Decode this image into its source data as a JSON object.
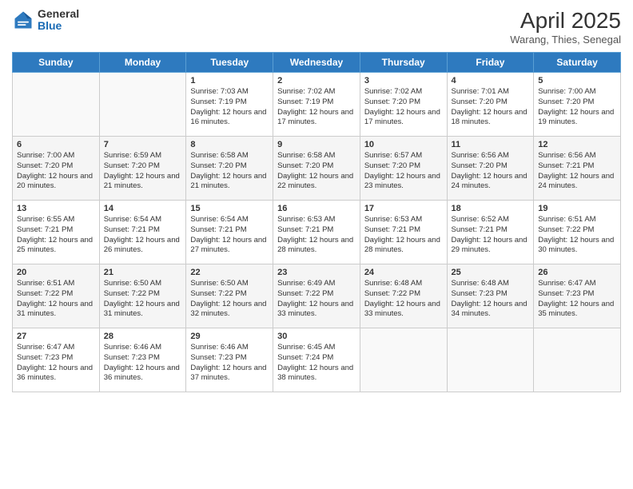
{
  "header": {
    "logo_general": "General",
    "logo_blue": "Blue",
    "title": "April 2025",
    "location": "Warang, Thies, Senegal"
  },
  "weekdays": [
    "Sunday",
    "Monday",
    "Tuesday",
    "Wednesday",
    "Thursday",
    "Friday",
    "Saturday"
  ],
  "weeks": [
    [
      {
        "day": "",
        "sunrise": "",
        "sunset": "",
        "daylight": ""
      },
      {
        "day": "",
        "sunrise": "",
        "sunset": "",
        "daylight": ""
      },
      {
        "day": "1",
        "sunrise": "Sunrise: 7:03 AM",
        "sunset": "Sunset: 7:19 PM",
        "daylight": "Daylight: 12 hours and 16 minutes."
      },
      {
        "day": "2",
        "sunrise": "Sunrise: 7:02 AM",
        "sunset": "Sunset: 7:19 PM",
        "daylight": "Daylight: 12 hours and 17 minutes."
      },
      {
        "day": "3",
        "sunrise": "Sunrise: 7:02 AM",
        "sunset": "Sunset: 7:20 PM",
        "daylight": "Daylight: 12 hours and 17 minutes."
      },
      {
        "day": "4",
        "sunrise": "Sunrise: 7:01 AM",
        "sunset": "Sunset: 7:20 PM",
        "daylight": "Daylight: 12 hours and 18 minutes."
      },
      {
        "day": "5",
        "sunrise": "Sunrise: 7:00 AM",
        "sunset": "Sunset: 7:20 PM",
        "daylight": "Daylight: 12 hours and 19 minutes."
      }
    ],
    [
      {
        "day": "6",
        "sunrise": "Sunrise: 7:00 AM",
        "sunset": "Sunset: 7:20 PM",
        "daylight": "Daylight: 12 hours and 20 minutes."
      },
      {
        "day": "7",
        "sunrise": "Sunrise: 6:59 AM",
        "sunset": "Sunset: 7:20 PM",
        "daylight": "Daylight: 12 hours and 21 minutes."
      },
      {
        "day": "8",
        "sunrise": "Sunrise: 6:58 AM",
        "sunset": "Sunset: 7:20 PM",
        "daylight": "Daylight: 12 hours and 21 minutes."
      },
      {
        "day": "9",
        "sunrise": "Sunrise: 6:58 AM",
        "sunset": "Sunset: 7:20 PM",
        "daylight": "Daylight: 12 hours and 22 minutes."
      },
      {
        "day": "10",
        "sunrise": "Sunrise: 6:57 AM",
        "sunset": "Sunset: 7:20 PM",
        "daylight": "Daylight: 12 hours and 23 minutes."
      },
      {
        "day": "11",
        "sunrise": "Sunrise: 6:56 AM",
        "sunset": "Sunset: 7:20 PM",
        "daylight": "Daylight: 12 hours and 24 minutes."
      },
      {
        "day": "12",
        "sunrise": "Sunrise: 6:56 AM",
        "sunset": "Sunset: 7:21 PM",
        "daylight": "Daylight: 12 hours and 24 minutes."
      }
    ],
    [
      {
        "day": "13",
        "sunrise": "Sunrise: 6:55 AM",
        "sunset": "Sunset: 7:21 PM",
        "daylight": "Daylight: 12 hours and 25 minutes."
      },
      {
        "day": "14",
        "sunrise": "Sunrise: 6:54 AM",
        "sunset": "Sunset: 7:21 PM",
        "daylight": "Daylight: 12 hours and 26 minutes."
      },
      {
        "day": "15",
        "sunrise": "Sunrise: 6:54 AM",
        "sunset": "Sunset: 7:21 PM",
        "daylight": "Daylight: 12 hours and 27 minutes."
      },
      {
        "day": "16",
        "sunrise": "Sunrise: 6:53 AM",
        "sunset": "Sunset: 7:21 PM",
        "daylight": "Daylight: 12 hours and 28 minutes."
      },
      {
        "day": "17",
        "sunrise": "Sunrise: 6:53 AM",
        "sunset": "Sunset: 7:21 PM",
        "daylight": "Daylight: 12 hours and 28 minutes."
      },
      {
        "day": "18",
        "sunrise": "Sunrise: 6:52 AM",
        "sunset": "Sunset: 7:21 PM",
        "daylight": "Daylight: 12 hours and 29 minutes."
      },
      {
        "day": "19",
        "sunrise": "Sunrise: 6:51 AM",
        "sunset": "Sunset: 7:22 PM",
        "daylight": "Daylight: 12 hours and 30 minutes."
      }
    ],
    [
      {
        "day": "20",
        "sunrise": "Sunrise: 6:51 AM",
        "sunset": "Sunset: 7:22 PM",
        "daylight": "Daylight: 12 hours and 31 minutes."
      },
      {
        "day": "21",
        "sunrise": "Sunrise: 6:50 AM",
        "sunset": "Sunset: 7:22 PM",
        "daylight": "Daylight: 12 hours and 31 minutes."
      },
      {
        "day": "22",
        "sunrise": "Sunrise: 6:50 AM",
        "sunset": "Sunset: 7:22 PM",
        "daylight": "Daylight: 12 hours and 32 minutes."
      },
      {
        "day": "23",
        "sunrise": "Sunrise: 6:49 AM",
        "sunset": "Sunset: 7:22 PM",
        "daylight": "Daylight: 12 hours and 33 minutes."
      },
      {
        "day": "24",
        "sunrise": "Sunrise: 6:48 AM",
        "sunset": "Sunset: 7:22 PM",
        "daylight": "Daylight: 12 hours and 33 minutes."
      },
      {
        "day": "25",
        "sunrise": "Sunrise: 6:48 AM",
        "sunset": "Sunset: 7:23 PM",
        "daylight": "Daylight: 12 hours and 34 minutes."
      },
      {
        "day": "26",
        "sunrise": "Sunrise: 6:47 AM",
        "sunset": "Sunset: 7:23 PM",
        "daylight": "Daylight: 12 hours and 35 minutes."
      }
    ],
    [
      {
        "day": "27",
        "sunrise": "Sunrise: 6:47 AM",
        "sunset": "Sunset: 7:23 PM",
        "daylight": "Daylight: 12 hours and 36 minutes."
      },
      {
        "day": "28",
        "sunrise": "Sunrise: 6:46 AM",
        "sunset": "Sunset: 7:23 PM",
        "daylight": "Daylight: 12 hours and 36 minutes."
      },
      {
        "day": "29",
        "sunrise": "Sunrise: 6:46 AM",
        "sunset": "Sunset: 7:23 PM",
        "daylight": "Daylight: 12 hours and 37 minutes."
      },
      {
        "day": "30",
        "sunrise": "Sunrise: 6:45 AM",
        "sunset": "Sunset: 7:24 PM",
        "daylight": "Daylight: 12 hours and 38 minutes."
      },
      {
        "day": "",
        "sunrise": "",
        "sunset": "",
        "daylight": ""
      },
      {
        "day": "",
        "sunrise": "",
        "sunset": "",
        "daylight": ""
      },
      {
        "day": "",
        "sunrise": "",
        "sunset": "",
        "daylight": ""
      }
    ]
  ]
}
